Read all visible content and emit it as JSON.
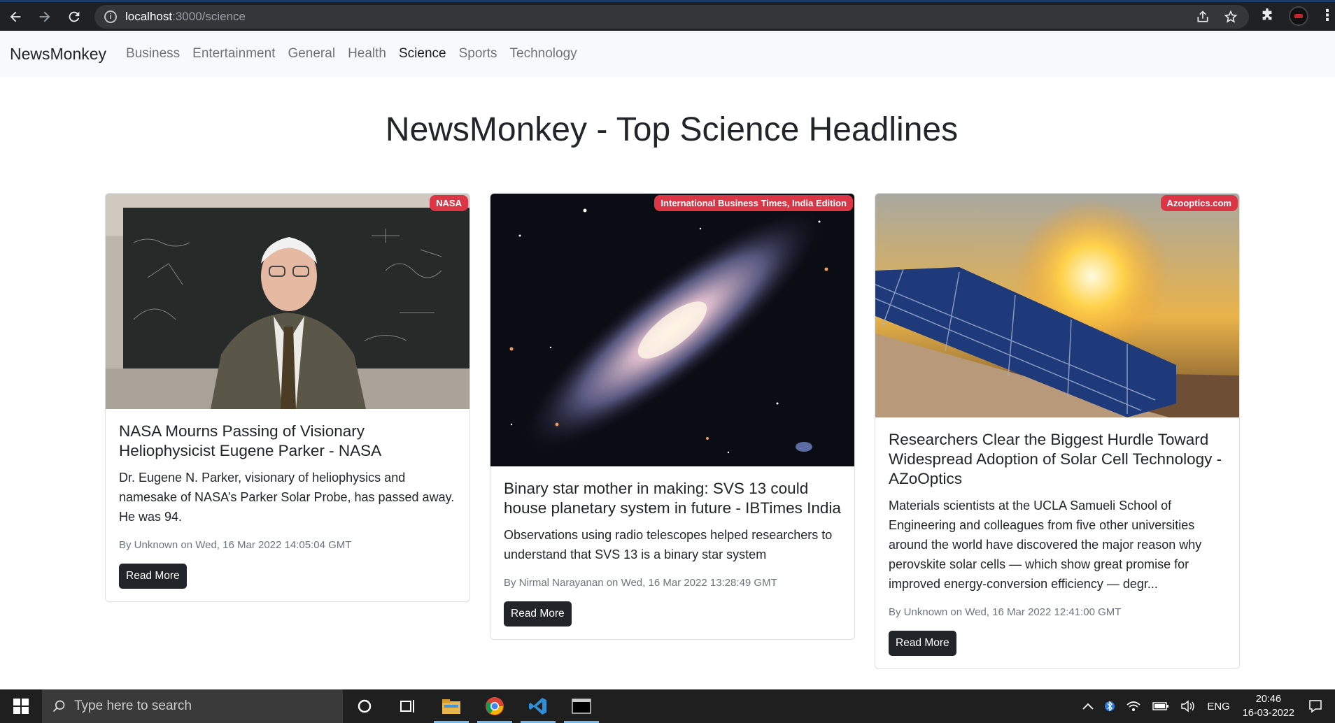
{
  "browser": {
    "url_host": "localhost",
    "url_path": ":3000/science"
  },
  "navbar": {
    "brand": "NewsMonkey",
    "links": [
      {
        "label": "Business",
        "active": false
      },
      {
        "label": "Entertainment",
        "active": false
      },
      {
        "label": "General",
        "active": false
      },
      {
        "label": "Health",
        "active": false
      },
      {
        "label": "Science",
        "active": true
      },
      {
        "label": "Sports",
        "active": false
      },
      {
        "label": "Technology",
        "active": false
      }
    ]
  },
  "page": {
    "title": "NewsMonkey - Top Science Headlines"
  },
  "cards": [
    {
      "source": "NASA",
      "title": "NASA Mourns Passing of Visionary Heliophysicist Eugene Parker - NASA",
      "description": "Dr. Eugene N. Parker, visionary of heliophysics and namesake of NASA’s Parker Solar Probe, has passed away. He was 94.",
      "meta": "By Unknown on Wed, 16 Mar 2022 14:05:04 GMT",
      "button": "Read More",
      "image": "portrait-photo"
    },
    {
      "source": "International Business Times, India Edition",
      "title": "Binary star mother in making: SVS 13 could house planetary system in future - IBTimes India",
      "description": "Observations using radio telescopes helped researchers to understand that SVS 13 is a binary star system",
      "meta": "By Nirmal Narayanan on Wed, 16 Mar 2022 13:28:49 GMT",
      "button": "Read More",
      "image": "galaxy-photo"
    },
    {
      "source": "Azooptics.com",
      "title": "Researchers Clear the Biggest Hurdle Toward Widespread Adoption of Solar Cell Technology - AZoOptics",
      "description": "Materials scientists at the UCLA Samueli School of Engineering and colleagues from five other universities around the world have discovered the major reason why perovskite solar cells — which show great promise for improved energy-conversion efficiency — degr...",
      "meta": "By Unknown on Wed, 16 Mar 2022 12:41:00 GMT",
      "button": "Read More",
      "image": "solar-panel-photo"
    }
  ],
  "taskbar": {
    "search_placeholder": "Type here to search",
    "lang": "ENG",
    "time": "20:46",
    "date": "16-03-2022"
  },
  "colors": {
    "badge": "#dc3545",
    "button": "#212529",
    "navbar_bg": "#f8f9fa"
  }
}
